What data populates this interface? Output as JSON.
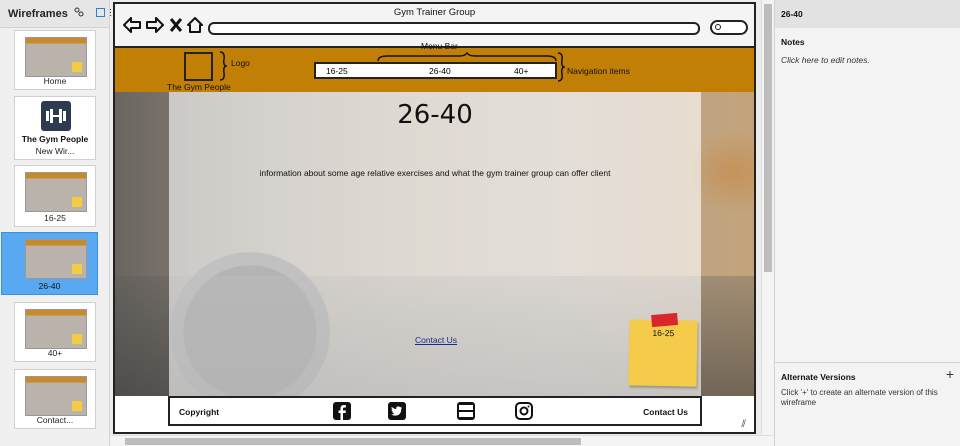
{
  "left_panel": {
    "title": "Wireframes",
    "pages": [
      {
        "label": "Home"
      },
      {
        "label": "New Wir...",
        "logo_text": "The Gym People"
      },
      {
        "label": "16-25"
      },
      {
        "label": "26-40",
        "selected": true
      },
      {
        "label": "40+"
      },
      {
        "label": "Contact..."
      }
    ]
  },
  "wireframe": {
    "window_title": "Gym Trainer Group",
    "menu_bar_annotation": "Menu Bar",
    "logo_annotation": "Logo",
    "logo_caption": "The Gym People",
    "nav_annotation": "Navigation items",
    "nav_items": [
      "16-25",
      "26-40",
      "40+"
    ],
    "heading": "26-40",
    "description": "information about some age relative exercises and what the gym trainer group can offer client",
    "contact_link": "Contact Us",
    "sticky_note": "16-25",
    "footer": {
      "copyright": "Copyright",
      "contact": "Contact Us",
      "social_icons": [
        "facebook-icon",
        "twitter-icon",
        "youtube-icon",
        "instagram-icon"
      ]
    }
  },
  "right_panel": {
    "title": "26-40",
    "notes_title": "Notes",
    "notes_placeholder": "Click here to edit notes.",
    "alt_title": "Alternate Versions",
    "alt_desc": "Click '+' to create an alternate version of this wireframe",
    "add_symbol": "+"
  },
  "colors": {
    "menu_bar": "#c27f06",
    "selection": "#59a8f2",
    "sticky_note": "#f5cc49",
    "tape": "#d9272e"
  }
}
